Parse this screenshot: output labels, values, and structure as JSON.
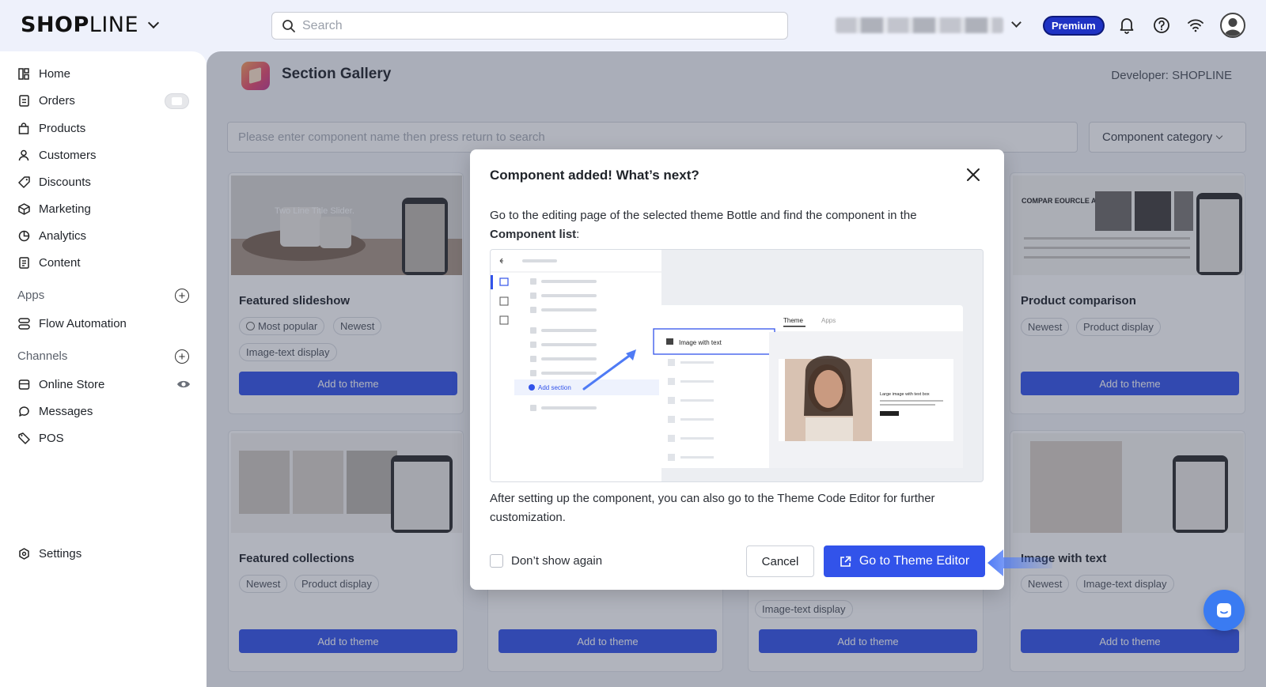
{
  "topbar": {
    "logo_prefix": "SH",
    "logo_o": "O",
    "logo_p": "P",
    "logo_suffix": "LINE",
    "search_placeholder": "Search",
    "plan_badge": "Premium"
  },
  "sidebar": {
    "items": [
      {
        "label": "Home",
        "icon": "home-grid-icon"
      },
      {
        "label": "Orders",
        "icon": "orders-icon"
      },
      {
        "label": "Products",
        "icon": "bag-icon"
      },
      {
        "label": "Customers",
        "icon": "person-icon"
      },
      {
        "label": "Discounts",
        "icon": "tag-icon"
      },
      {
        "label": "Marketing",
        "icon": "cube-icon"
      },
      {
        "label": "Analytics",
        "icon": "pie-chart-icon"
      },
      {
        "label": "Content",
        "icon": "document-icon"
      }
    ],
    "apps_heading": "Apps",
    "apps": [
      {
        "label": "Flow Automation",
        "icon": "flow-icon"
      }
    ],
    "channels_heading": "Channels",
    "channels": [
      {
        "label": "Online Store",
        "icon": "store-icon"
      },
      {
        "label": "Messages",
        "icon": "chat-icon"
      },
      {
        "label": "POS",
        "icon": "pos-tag-icon"
      }
    ],
    "settings_label": "Settings"
  },
  "main": {
    "app_title": "Section Gallery",
    "developer": "Developer: SHOPLINE",
    "search_placeholder": "Please enter component name then press return to search",
    "category_label": "Component category",
    "add_label": "Add to theme",
    "cards": [
      {
        "title": "Featured slideshow",
        "tags": [
          "Most popular",
          "Newest",
          "Image-text display"
        ],
        "image_caption": "Two Line Title Slider."
      },
      {
        "title": "Product comparison",
        "tags": [
          "Newest",
          "Product display"
        ],
        "image_caption": "COMPAR EOURCLE ANSERS"
      },
      {
        "title": "Featured collections",
        "tags": [
          "Newest",
          "Product display"
        ]
      },
      {
        "title": "Image with text",
        "tags": [
          "Newest",
          "Image-text display"
        ]
      },
      {
        "tags": [
          "Image-text display"
        ]
      }
    ]
  },
  "modal": {
    "title": "Component added! What’s next?",
    "body_prefix": "Go to the editing page of the selected theme Bottle and find the component in the ",
    "body_highlight": "Component list",
    "body_suffix": ":",
    "illustration": {
      "tab_theme": "Theme",
      "tab_apps": "Apps",
      "selected_item": "Image with text",
      "add_section": "Add section",
      "preview_heading": "Large image with text box"
    },
    "body2": "After setting up the component, you can also go to the Theme Code Editor for further customization.",
    "dont_show": "Don’t show again",
    "cancel": "Cancel",
    "primary": "Go to Theme Editor"
  },
  "colors": {
    "accent": "#3253ea",
    "premium": "#1f33c4",
    "callout": "#4f7bf5"
  }
}
